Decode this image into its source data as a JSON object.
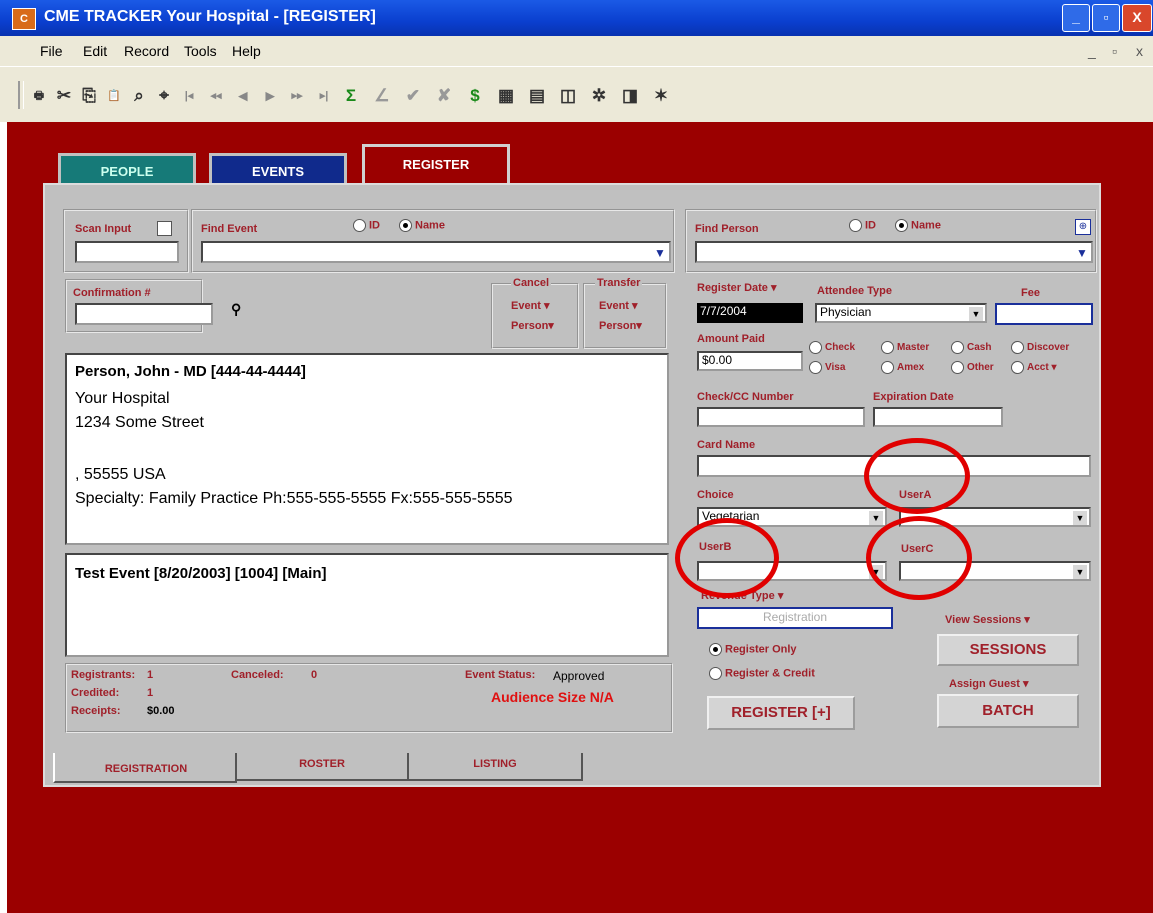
{
  "window": {
    "icon_text": "C",
    "title": "CME TRACKER   Your Hospital - [REGISTER]",
    "min": "_",
    "max": "▫",
    "close": "X"
  },
  "menu": {
    "items": [
      "File",
      "Edit",
      "Record",
      "Tools",
      "Help"
    ],
    "mdi_min": "_",
    "mdi_restore": "▫",
    "mdi_close": "x"
  },
  "toolbar": {
    "icons": [
      "print-icon",
      "cut-icon",
      "copy-icon",
      "paste-icon",
      "find-icon",
      "find-replace-icon",
      "first-record-icon",
      "prev-page-icon",
      "prev-record-icon",
      "next-record-icon",
      "next-page-icon",
      "last-record-icon",
      "sum-icon",
      "ruler-icon",
      "check-icon",
      "cancel-icon",
      "dollar-icon",
      "calendar-icon",
      "document-icon",
      "book-icon",
      "tree-icon",
      "chart-icon",
      "tools-icon"
    ],
    "glyphs": [
      "🖶",
      "✂",
      "⎘",
      "📋",
      "⌕",
      "⌖",
      "|◂",
      "◂◂",
      "◂",
      "▸",
      "▸▸",
      "▸|",
      "Σ",
      "∠",
      "✔",
      "✘",
      "$",
      "▦",
      "▤",
      "◫",
      "✲",
      "◨",
      "✶"
    ]
  },
  "tabs": {
    "people": "PEOPLE",
    "events": "EVENTS",
    "register": "REGISTER"
  },
  "scan": {
    "label": "Scan Input",
    "value": ""
  },
  "find_event": {
    "label": "Find Event",
    "opt_id": "ID",
    "opt_name": "Name",
    "value": ""
  },
  "find_person": {
    "label": "Find Person",
    "opt_id": "ID",
    "opt_name": "Name",
    "value": ""
  },
  "confirmation": {
    "label": "Confirmation #",
    "value": ""
  },
  "cancel": {
    "label": "Cancel",
    "event": "Event",
    "person": "Person"
  },
  "transfer": {
    "label": "Transfer",
    "event": "Event",
    "person": "Person"
  },
  "person": {
    "name": "Person, John - MD [444-44-4444]",
    "org": "Your Hospital",
    "street": "1234 Some Street",
    "city": ", 55555  USA",
    "specialty": "Specialty: Family Practice    Ph:555-555-5555 Fx:555-555-5555"
  },
  "event": {
    "title": "Test Event [8/20/2003] [1004] [Main]"
  },
  "stats": {
    "registrants_label": "Registrants:",
    "registrants": "1",
    "credited_label": "Credited:",
    "credited": "1",
    "receipts_label": "Receipts:",
    "receipts": "$0.00",
    "canceled_label": "Canceled:",
    "canceled": "0",
    "status_label": "Event Status:",
    "status": "Approved",
    "audience": "Audience Size N/A"
  },
  "register": {
    "date_label": "Register Date",
    "date": "7/7/2004",
    "attendee_label": "Attendee Type",
    "attendee": "Physician",
    "fee_label": "Fee",
    "fee": "",
    "amount_label": "Amount Paid",
    "amount": "$0.00",
    "pay_options": [
      "Check",
      "Master",
      "Cash",
      "Discover",
      "Visa",
      "Amex",
      "Other",
      "Acct"
    ],
    "cc_label": "Check/CC Number",
    "cc": "",
    "exp_label": "Expiration Date",
    "exp": "",
    "card_label": "Card Name",
    "card": "",
    "choice_label": "Choice",
    "choice": "Vegetarian",
    "usera_label": "UserA",
    "usera": "",
    "userb_label": "UserB",
    "userb": "",
    "userc_label": "UserC",
    "userc": "",
    "revenue_label": "Revenue Type",
    "revenue": "Registration",
    "register_only": "Register Only",
    "register_credit": "Register & Credit",
    "view_sessions": "View Sessions",
    "sessions_btn": "SESSIONS",
    "assign_guest": "Assign Guest",
    "register_btn": "REGISTER [+]",
    "batch_btn": "BATCH"
  },
  "bottom_tabs": {
    "registration": "REGISTRATION",
    "roster": "ROSTER",
    "listing": "LISTING"
  }
}
